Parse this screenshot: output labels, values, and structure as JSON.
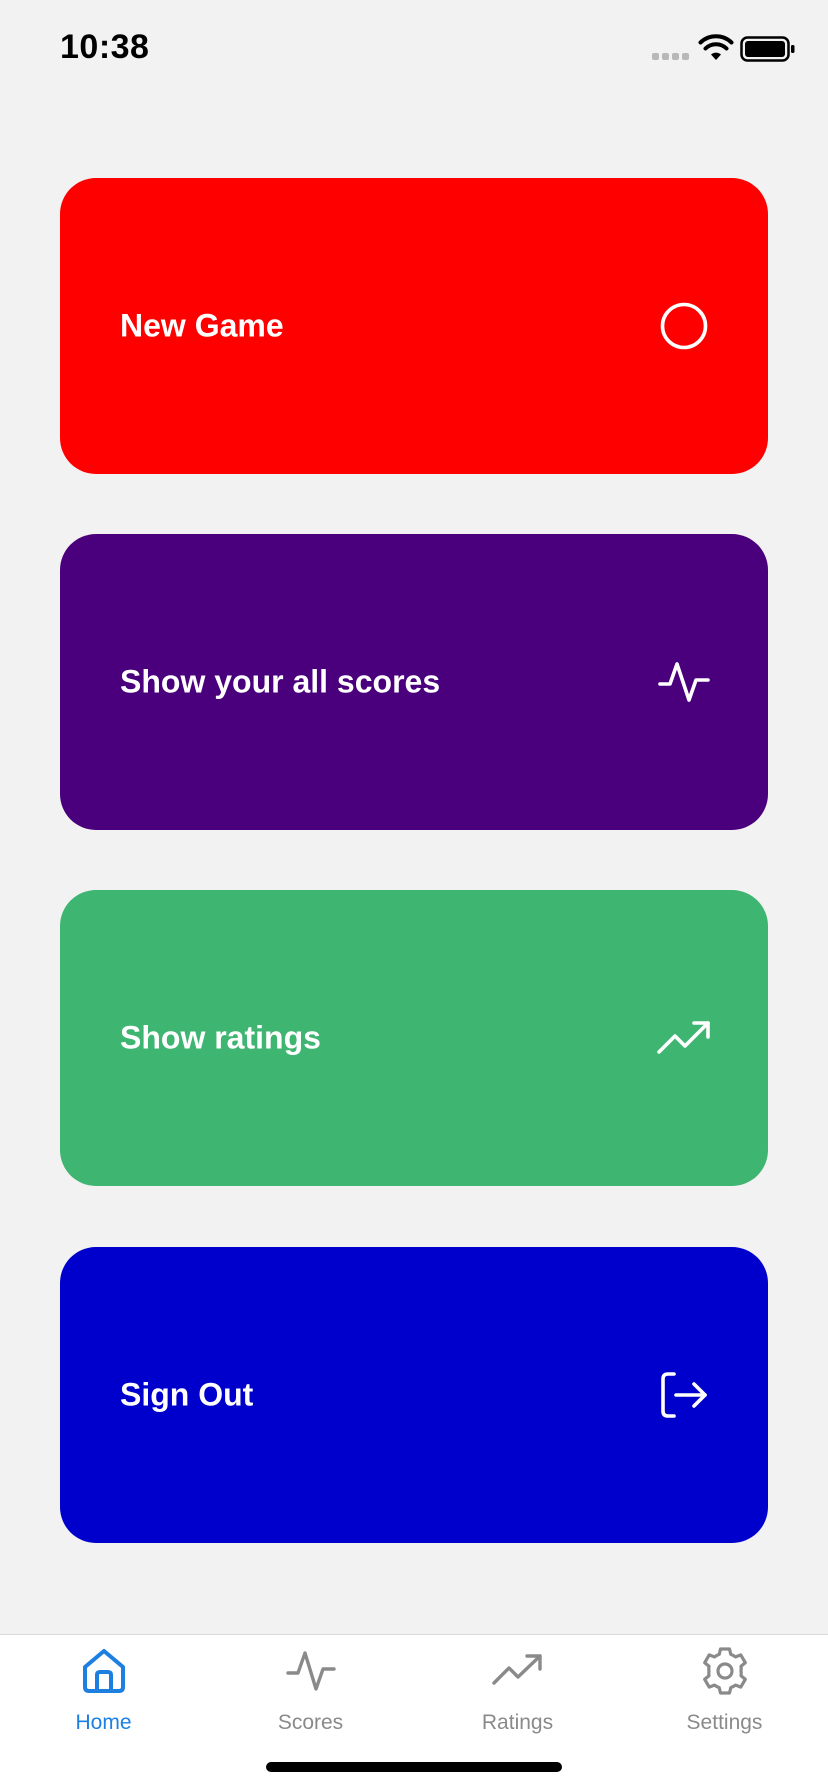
{
  "status_bar": {
    "time": "10:38"
  },
  "cards": [
    {
      "label": "New Game",
      "icon": "circle-icon",
      "color": "#ff0000"
    },
    {
      "label": "Show your all scores",
      "icon": "activity-icon",
      "color": "#4a007d"
    },
    {
      "label": "Show ratings",
      "icon": "trending-up-icon",
      "color": "#3fb572"
    },
    {
      "label": "Sign Out",
      "icon": "log-out-icon",
      "color": "#0000cc"
    }
  ],
  "tab_bar": {
    "items": [
      {
        "label": "Home",
        "icon": "home-icon",
        "active": true
      },
      {
        "label": "Scores",
        "icon": "activity-icon",
        "active": false
      },
      {
        "label": "Ratings",
        "icon": "trending-up-icon",
        "active": false
      },
      {
        "label": "Settings",
        "icon": "gear-icon",
        "active": false
      }
    ],
    "active_color": "#1d7fe0",
    "inactive_color": "#8a8a8a"
  }
}
